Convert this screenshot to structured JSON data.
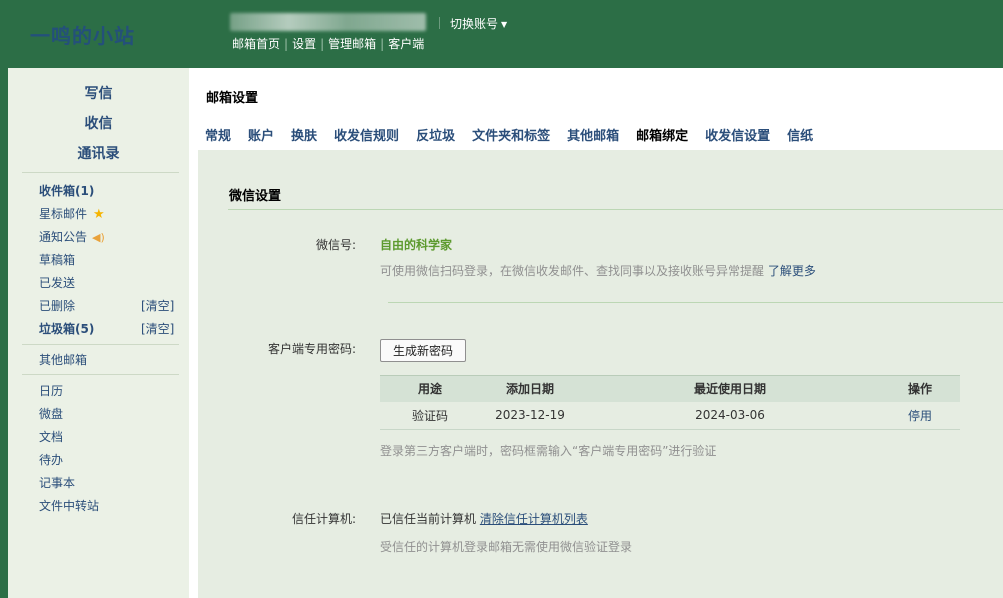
{
  "header": {
    "logo": "一鸣的小站",
    "switch_account": "切换账号",
    "links": [
      "邮箱首页",
      "设置",
      "管理邮箱",
      "客户端"
    ]
  },
  "sidebar": {
    "quick": [
      "写信",
      "收信",
      "通讯录"
    ],
    "folders": [
      {
        "label": "收件箱(1)",
        "bold": true
      },
      {
        "label": "星标邮件",
        "icon": "star-icon"
      },
      {
        "label": "通知公告",
        "icon": "speaker-icon"
      },
      {
        "label": "草稿箱"
      },
      {
        "label": "已发送"
      },
      {
        "label": "已删除",
        "action": "[清空]"
      },
      {
        "label": "垃圾箱(5)",
        "bold": true,
        "action": "[清空]"
      }
    ],
    "other_mailbox": "其他邮箱",
    "tools": [
      "日历",
      "微盘",
      "文档",
      "待办",
      "记事本",
      "文件中转站"
    ]
  },
  "main": {
    "title": "邮箱设置",
    "tabs": [
      "常规",
      "账户",
      "换肤",
      "收发信规则",
      "反垃圾",
      "文件夹和标签",
      "其他邮箱",
      "邮箱绑定",
      "收发信设置",
      "信纸"
    ],
    "active_tab": "邮箱绑定",
    "section_title": "微信设置",
    "wechat": {
      "label": "微信号:",
      "value": "自由的科学家",
      "hint": "可使用微信扫码登录，在微信收发邮件、查找同事以及接收账号异常提醒",
      "learn_more": "了解更多"
    },
    "client_pwd": {
      "label": "客户端专用密码:",
      "button": "生成新密码",
      "table_headers": [
        "用途",
        "添加日期",
        "最近使用日期",
        "操作"
      ],
      "rows": [
        [
          "验证码",
          "2023-12-19",
          "2024-03-06",
          "停用"
        ]
      ],
      "hint": "登录第三方客户端时，密码框需输入“客户端专用密码”进行验证"
    },
    "trusted": {
      "label": "信任计算机:",
      "status": "已信任当前计算机",
      "clear_link": "清除信任计算机列表",
      "hint": "受信任的计算机登录邮箱无需使用微信验证登录"
    }
  },
  "colors": {
    "header_bg": "#2c6e46",
    "sidebar_bg": "#ebf1e6",
    "panel_bg": "#e6ede2",
    "link": "#2b4e7a",
    "accent_green": "#5c9a2e"
  }
}
